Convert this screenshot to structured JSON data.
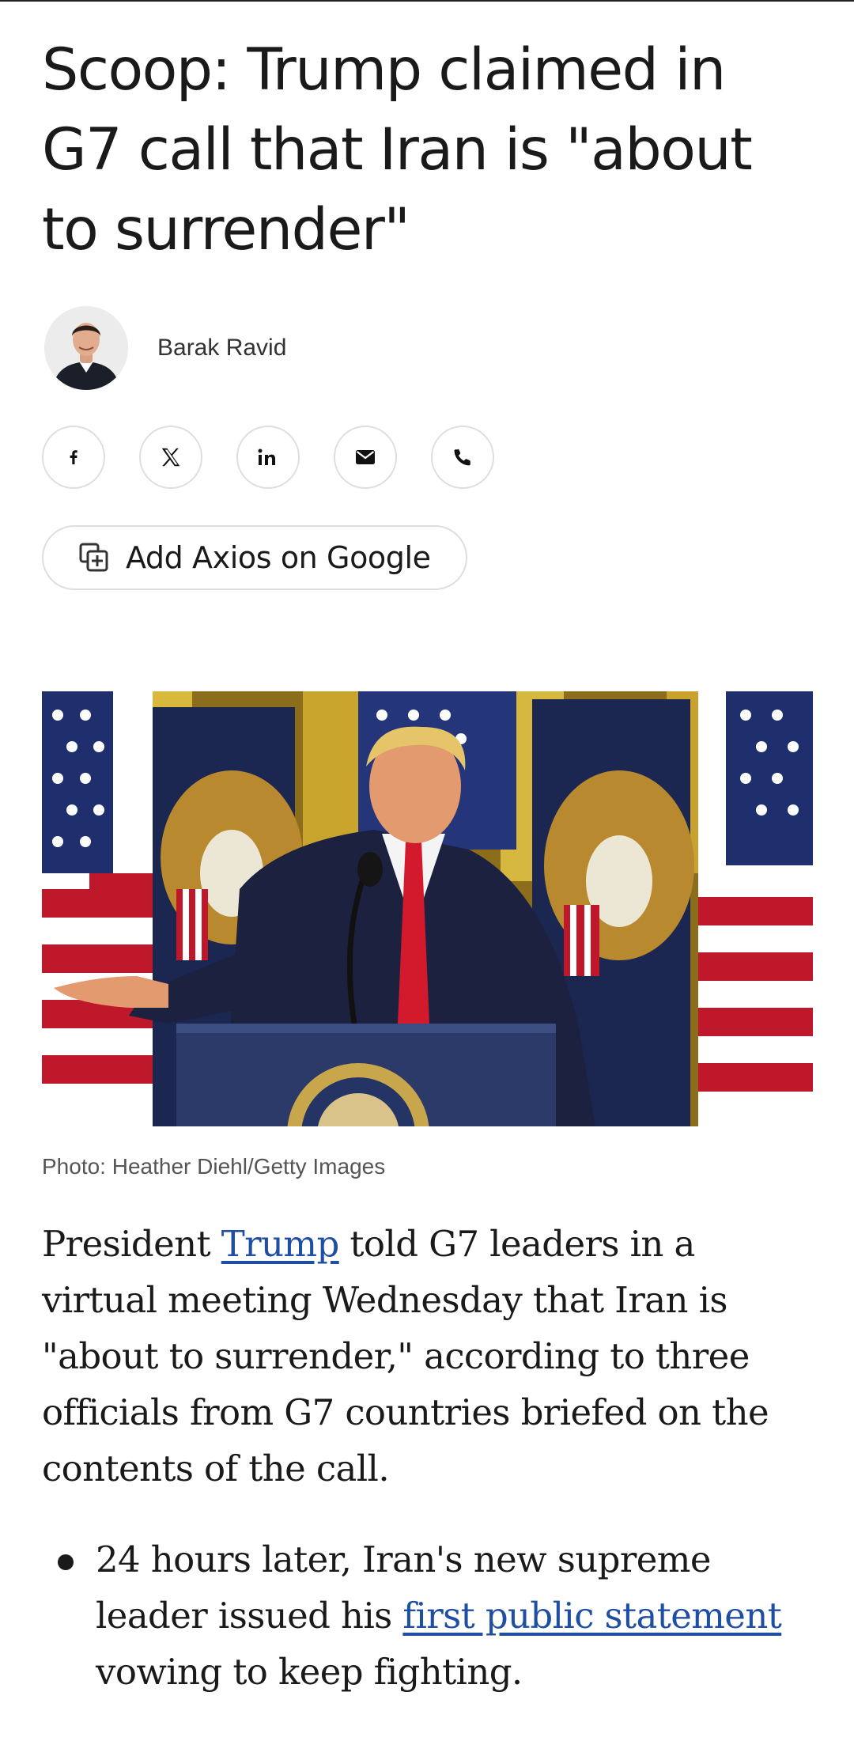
{
  "article": {
    "headline": "Scoop: Trump claimed in G7 call that Iran is \"about to surrender\"",
    "author": "Barak Ravid",
    "share_buttons": [
      {
        "icon": "facebook-icon"
      },
      {
        "icon": "x-icon"
      },
      {
        "icon": "linkedin-icon"
      },
      {
        "icon": "email-icon"
      },
      {
        "icon": "phone-icon"
      }
    ],
    "google_button": {
      "label": "Add Axios on Google",
      "icon": "add-source-icon"
    },
    "photo_caption": "Photo: Heather Diehl/Getty Images",
    "lead": {
      "before_link": "President ",
      "link": "Trump",
      "after_link": " told G7 leaders in a virtual meeting Wednesday that Iran is \"about to surrender,\" according to three officials from G7 countries briefed on the contents of the call."
    },
    "bullets": [
      {
        "before_link": "24 hours later, Iran's new supreme leader issued his ",
        "link": "first public statement",
        "after_link": " vowing to keep fighting."
      }
    ]
  },
  "colors": {
    "link": "#1f4fa3",
    "border": "#dedede",
    "text": "#1a1a1a",
    "caption": "#555555"
  }
}
